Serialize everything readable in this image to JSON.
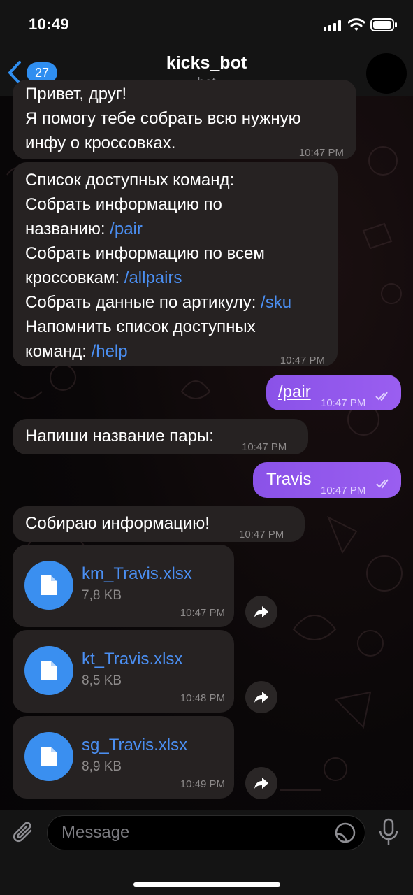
{
  "status_bar": {
    "time": "10:49"
  },
  "header": {
    "back_count": "27",
    "title": "kicks_bot",
    "subtitle": "bot"
  },
  "messages": [
    {
      "text": "Привет, друг!\n Я помогу тебе собрать всю нужную инфу о кроссовках.",
      "time": "10:47 PM"
    },
    {
      "line1": "Список доступных команд:",
      "line2a": "Собрать информацию по",
      "line2b": "названию: ",
      "cmd1": "/pair",
      "line3a": "Собрать информацию по всем",
      "line3b": "кроссовкам: ",
      "cmd2": "/allpairs",
      "line4": "Собрать данные по артикулу: ",
      "cmd3": "/sku",
      "line5a": "Напомнить список доступных",
      "line5b": "команд: ",
      "cmd4": "/help",
      "time": "10:47 PM"
    },
    {
      "text": "/pair",
      "time": "10:47 PM"
    },
    {
      "text": "Напиши название пары:",
      "time": "10:47 PM"
    },
    {
      "text": "Travis",
      "time": "10:47 PM"
    },
    {
      "text": "Собираю информацию!",
      "time": "10:47 PM"
    }
  ],
  "files": [
    {
      "name": "km_Travis.xlsx",
      "size": "7,8 KB",
      "time": "10:47 PM"
    },
    {
      "name": "kt_Travis.xlsx",
      "size": "8,5 KB",
      "time": "10:48 PM"
    },
    {
      "name": "sg_Travis.xlsx",
      "size": "8,9 KB",
      "time": "10:49 PM"
    }
  ],
  "input": {
    "placeholder": "Message",
    "value": ""
  },
  "colors": {
    "accent": "#3a8ff0",
    "outgoing": "#9a5ef0",
    "incoming": "#262222"
  }
}
